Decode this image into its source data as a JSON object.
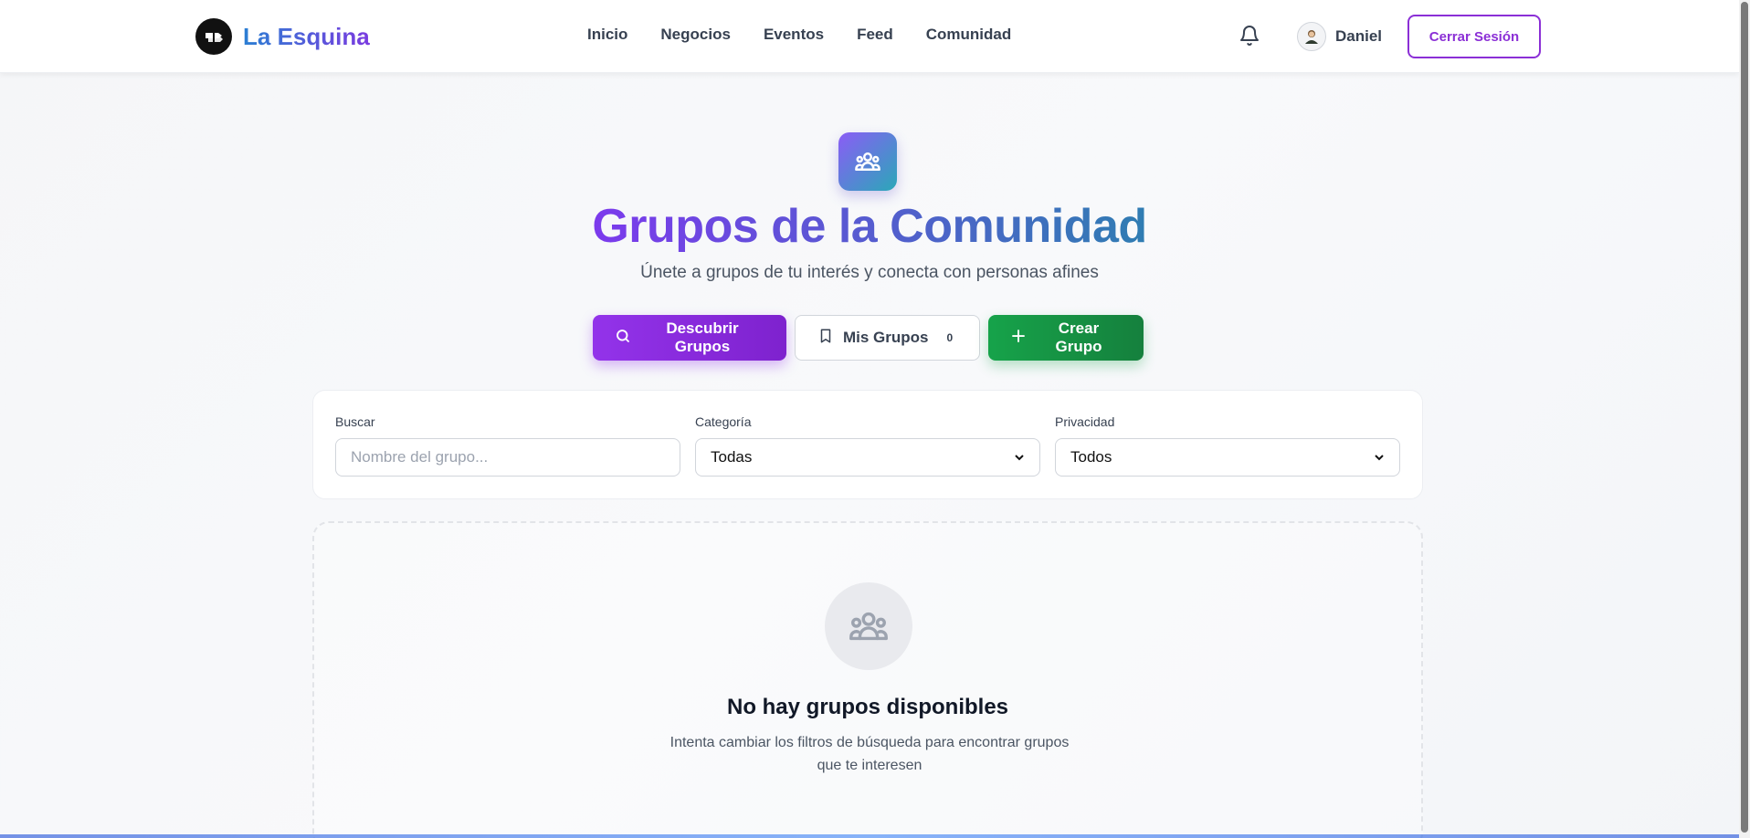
{
  "header": {
    "brand_name": "La Esquina",
    "nav": [
      "Inicio",
      "Negocios",
      "Eventos",
      "Feed",
      "Comunidad"
    ],
    "user_name": "Daniel",
    "logout_label": "Cerrar Sesión"
  },
  "hero": {
    "title": "Grupos de la Comunidad",
    "subtitle": "Únete a grupos de tu interés y conecta con personas afines"
  },
  "actions": {
    "discover_label": "Descubrir Grupos",
    "mine_label": "Mis Grupos",
    "mine_count": "0",
    "create_label": "Crear Grupo"
  },
  "filters": {
    "search_label": "Buscar",
    "search_placeholder": "Nombre del grupo...",
    "category_label": "Categoría",
    "category_value": "Todas",
    "privacy_label": "Privacidad",
    "privacy_value": "Todos"
  },
  "empty": {
    "title": "No hay grupos disponibles",
    "text": "Intenta cambiar los filtros de búsqueda para encontrar grupos que te interesen"
  },
  "colors": {
    "accent_purple": "#8b2fd6",
    "accent_green": "#16a34a"
  },
  "icons": [
    "logo-icon",
    "bell-icon",
    "avatar-icon",
    "search-icon",
    "bookmark-icon",
    "plus-icon",
    "users-icon",
    "chevron-down-icon"
  ]
}
